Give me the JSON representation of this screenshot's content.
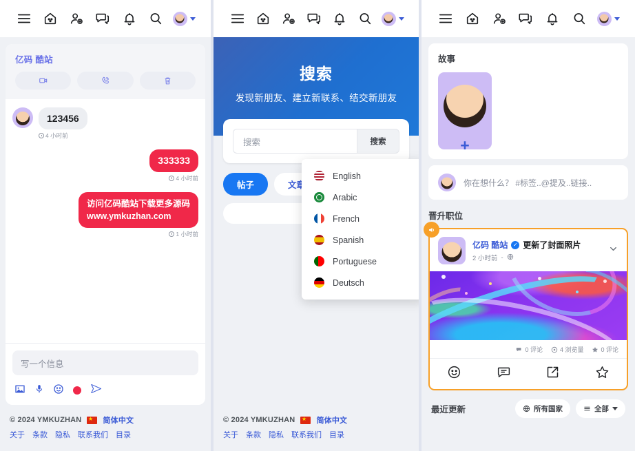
{
  "topnav": {
    "icons": [
      "menu-icon",
      "home-icon",
      "add-friend-icon",
      "messages-icon",
      "bell-icon",
      "search-icon"
    ],
    "avatar": "avatar"
  },
  "left": {
    "chat": {
      "title": "亿码 酷站",
      "actions": [
        "video-call",
        "voice-call",
        "delete"
      ],
      "messages": [
        {
          "side": "them",
          "text": "123456",
          "time": "4 小时前"
        },
        {
          "side": "me",
          "text": "333333",
          "time": "4 小时前"
        },
        {
          "side": "me",
          "line1": "访问亿码酷站下载更多源码",
          "line2": "www.ymkuzhan.com",
          "time": "1 小时前"
        }
      ],
      "composer_placeholder": "写一个信息",
      "composer_icons": [
        "image-icon",
        "mic-icon",
        "emoji-icon",
        "record-icon",
        "send-icon"
      ]
    },
    "footer": {
      "copyright": "© 2024 YMKUZHAN",
      "language": "简体中文",
      "links": [
        "关于",
        "条款",
        "隐私",
        "联系我们",
        "目录"
      ]
    }
  },
  "middle": {
    "hero": {
      "title": "搜索",
      "subtitle": "发现新朋友、建立新联系、结交新朋友"
    },
    "search": {
      "placeholder": "搜索",
      "button": "搜索"
    },
    "tabs": [
      {
        "label": "帖子",
        "active": true
      },
      {
        "label": "文章",
        "active": false
      }
    ],
    "language_menu": [
      {
        "label": "English",
        "flag": "us"
      },
      {
        "label": "Arabic",
        "flag": "sa"
      },
      {
        "label": "French",
        "flag": "fr"
      },
      {
        "label": "Spanish",
        "flag": "es"
      },
      {
        "label": "Portuguese",
        "flag": "pt"
      },
      {
        "label": "Deutsch",
        "flag": "de"
      }
    ],
    "footer": {
      "copyright": "© 2024 YMKUZHAN",
      "language": "简体中文",
      "links": [
        "关于",
        "条款",
        "隐私",
        "联系我们",
        "目录"
      ]
    }
  },
  "right": {
    "story": {
      "title": "故事",
      "add": "+"
    },
    "composer_placeholder": "你在想什么？ #标签..@提及..链接..",
    "promoted_title": "晋升职位",
    "post": {
      "author": "亿码 酷站",
      "verified": true,
      "action": "更新了封面照片",
      "time": "2 小时前",
      "privacy": "globe-icon",
      "stats": [
        {
          "icon": "comment-icon",
          "label": "0 评论"
        },
        {
          "icon": "eye-icon",
          "label": "4 浏览量"
        },
        {
          "icon": "star-icon",
          "label": "0 评论"
        }
      ],
      "actions": [
        "react-icon",
        "comment-icon",
        "share-icon",
        "favorite-icon"
      ]
    },
    "bottom": {
      "title": "最近更新",
      "filters": [
        {
          "label": "所有国家",
          "icon": "globe-icon"
        },
        {
          "label": "全部",
          "icon": "list-icon",
          "chevron": true
        }
      ]
    }
  },
  "colors": {
    "brand_blue": "#1877f2",
    "link_blue": "#3b5bd6",
    "accent_red": "#f02849",
    "promo_orange": "#f7a028",
    "purple_avatar": "#cdbcf5"
  }
}
